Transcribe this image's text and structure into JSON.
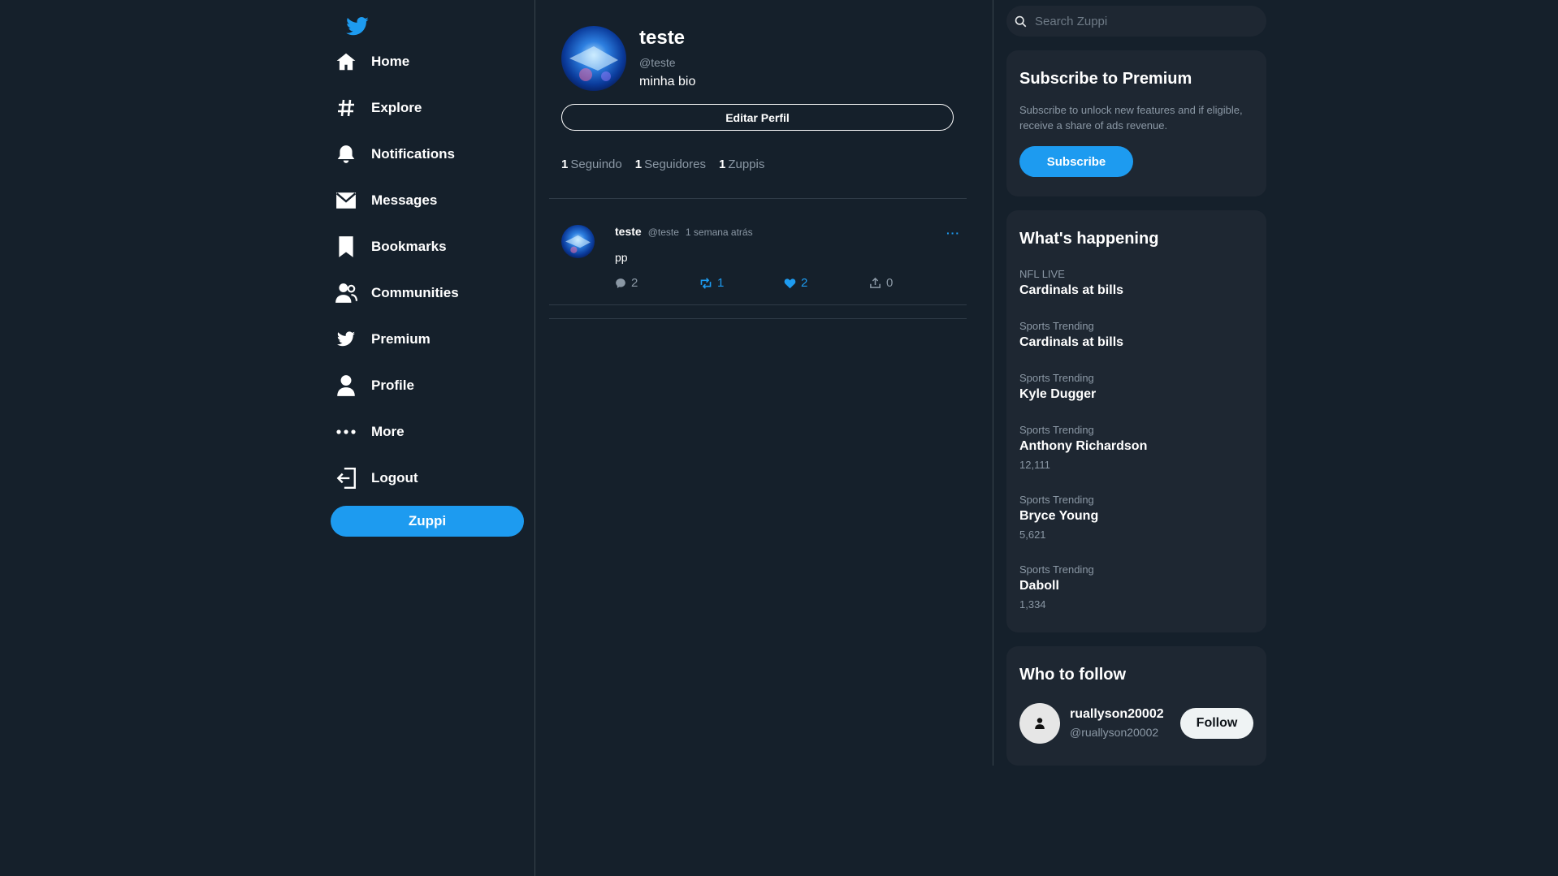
{
  "nav": {
    "logo_icon": "bird-icon",
    "items": [
      {
        "label": "Home",
        "icon": "home-icon"
      },
      {
        "label": "Explore",
        "icon": "hashtag-icon"
      },
      {
        "label": "Notifications",
        "icon": "bell-icon"
      },
      {
        "label": "Messages",
        "icon": "envelope-icon"
      },
      {
        "label": "Bookmarks",
        "icon": "bookmark-icon"
      },
      {
        "label": "Communities",
        "icon": "users-icon"
      },
      {
        "label": "Premium",
        "icon": "bird-icon"
      },
      {
        "label": "Profile",
        "icon": "user-icon"
      },
      {
        "label": "More",
        "icon": "more-dots-icon"
      },
      {
        "label": "Logout",
        "icon": "logout-icon"
      }
    ],
    "compose_label": "Zuppi"
  },
  "profile": {
    "name": "teste",
    "handle": "@teste",
    "bio": "minha bio",
    "edit_label": "Editar Perfil",
    "stats": [
      {
        "count": "1",
        "label": "Seguindo"
      },
      {
        "count": "1",
        "label": "Seguidores"
      },
      {
        "count": "1",
        "label": "Zuppis"
      }
    ]
  },
  "post": {
    "name": "teste",
    "handle": "@teste",
    "time": "1 semana atrás",
    "more": "···",
    "text": "pp",
    "replies": "2",
    "rezuppis": "1",
    "likes": "2",
    "shares": "0"
  },
  "search": {
    "placeholder": "Search Zuppi"
  },
  "premium": {
    "title": "Subscribe to Premium",
    "description": "Subscribe to unlock new features and if eligible, receive a share of ads revenue.",
    "button": "Subscribe"
  },
  "happening": {
    "title": "What's happening",
    "trends": [
      {
        "category": "NFL LIVE",
        "title": "Cardinals at bills",
        "count": ""
      },
      {
        "category": "Sports Trending",
        "title": "Cardinals at bills",
        "count": ""
      },
      {
        "category": "Sports Trending",
        "title": "Kyle Dugger",
        "count": ""
      },
      {
        "category": "Sports Trending",
        "title": "Anthony Richardson",
        "count": "12,111"
      },
      {
        "category": "Sports Trending",
        "title": "Bryce Young",
        "count": "5,621"
      },
      {
        "category": "Sports Trending",
        "title": "Daboll",
        "count": "1,334"
      }
    ]
  },
  "who_to_follow": {
    "title": "Who to follow",
    "name": "ruallyson20002",
    "handle": "@ruallyson20002",
    "button": "Follow"
  },
  "colors": {
    "background": "#15202b",
    "accent": "#1d9bf0",
    "card": "#1e2732",
    "muted": "#8b98a5"
  }
}
